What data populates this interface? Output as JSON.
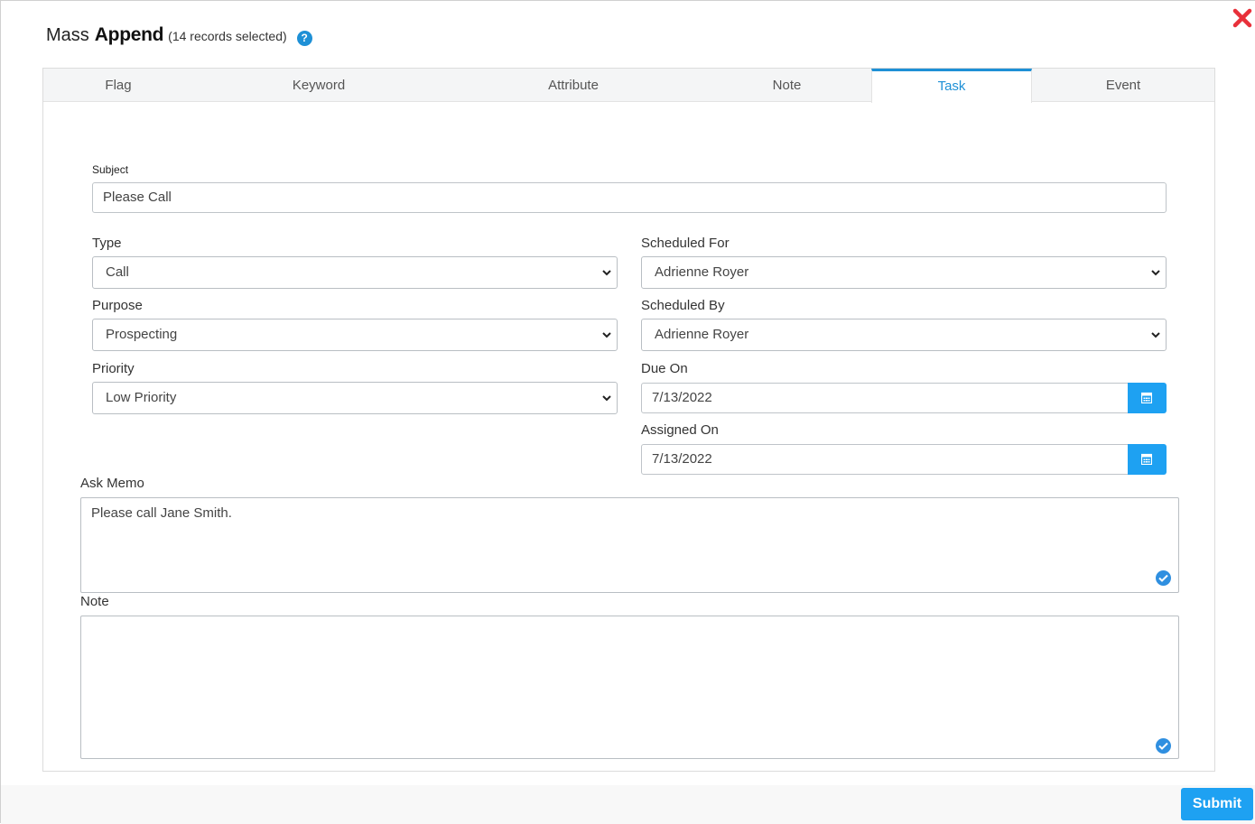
{
  "dialog": {
    "title_light": "Mass",
    "title_bold": "Append",
    "title_sub": "(14 records selected)",
    "help_glyph": "?",
    "close_icon": "close-x-icon",
    "accent_color": "#1ea1f2",
    "close_color": "#e8303a"
  },
  "tabs": [
    {
      "label": "Flag",
      "active": false
    },
    {
      "label": "Keyword",
      "active": false
    },
    {
      "label": "Attribute",
      "active": false
    },
    {
      "label": "Note",
      "active": false
    },
    {
      "label": "Task",
      "active": true
    },
    {
      "label": "Event",
      "active": false
    }
  ],
  "form": {
    "subject": {
      "label": "Subject",
      "value": "Please Call"
    },
    "type": {
      "label": "Type",
      "value": "Call"
    },
    "purpose": {
      "label": "Purpose",
      "value": "Prospecting"
    },
    "priority": {
      "label": "Priority",
      "value": "Low Priority"
    },
    "scheduled_for": {
      "label": "Scheduled For",
      "value": "Adrienne Royer"
    },
    "scheduled_by": {
      "label": "Scheduled By",
      "value": "Adrienne Royer"
    },
    "due_on": {
      "label": "Due On",
      "value": "7/13/2022"
    },
    "assigned_on": {
      "label": "Assigned On",
      "value": "7/13/2022"
    },
    "ask_memo": {
      "label": "Ask Memo",
      "value": "Please call Jane Smith."
    },
    "note": {
      "label": "Note",
      "value": ""
    }
  },
  "footer": {
    "submit_label": "Submit"
  }
}
